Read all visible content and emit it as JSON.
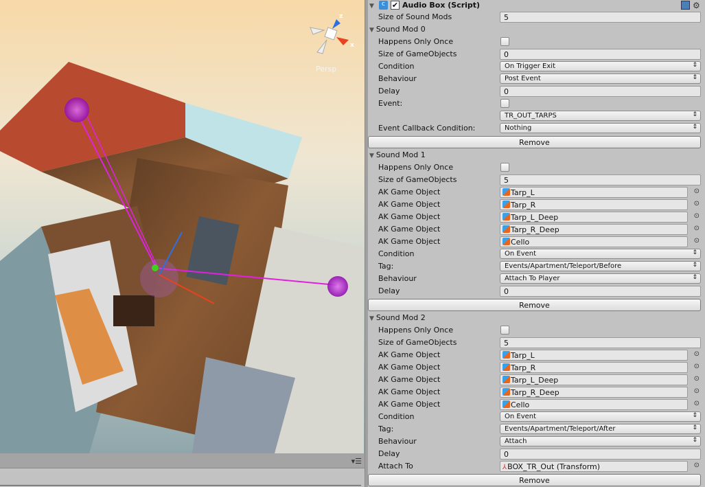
{
  "scene": {
    "view_mode": "Persp",
    "gizmo_axes": {
      "z": "z",
      "x": "x"
    }
  },
  "inspector": {
    "component": {
      "title": "Audio Box (Script)",
      "enabled": true,
      "icons": [
        "script-icon",
        "help-book-icon",
        "gear-icon"
      ]
    },
    "size_of_sound_mods": {
      "label": "Size of Sound Mods",
      "value": "5"
    },
    "sound_mods": [
      {
        "title": "Sound Mod 0",
        "rows": [
          {
            "type": "checkbox",
            "label": "Happens Only Once",
            "checked": false
          },
          {
            "type": "text",
            "label": "Size of GameObjects",
            "value": "0"
          },
          {
            "type": "dropdown",
            "label": "Condition",
            "value": "On Trigger Exit"
          },
          {
            "type": "dropdown",
            "label": "Behaviour",
            "value": "Post Event"
          },
          {
            "type": "text",
            "label": "Delay",
            "value": "0"
          },
          {
            "type": "checkbox",
            "label": "Event:",
            "checked": false
          },
          {
            "type": "dropdown",
            "label": "",
            "value": "TR_OUT_TARPS"
          },
          {
            "type": "dropdown",
            "label": "Event Callback Condition:",
            "value": "Nothing"
          }
        ],
        "remove_label": "Remove"
      },
      {
        "title": "Sound Mod 1",
        "rows": [
          {
            "type": "checkbox",
            "label": "Happens Only Once",
            "checked": false
          },
          {
            "type": "text",
            "label": "Size of GameObjects",
            "value": "5"
          },
          {
            "type": "object",
            "label": "AK Game Object",
            "value": "Tarp_L",
            "icon": "gameobject-icon"
          },
          {
            "type": "object",
            "label": "AK Game Object",
            "value": "Tarp_R",
            "icon": "gameobject-icon"
          },
          {
            "type": "object",
            "label": "AK Game Object",
            "value": "Tarp_L_Deep",
            "icon": "gameobject-icon"
          },
          {
            "type": "object",
            "label": "AK Game Object",
            "value": "Tarp_R_Deep",
            "icon": "gameobject-icon"
          },
          {
            "type": "object",
            "label": "AK Game Object",
            "value": "Cello",
            "icon": "gameobject-icon"
          },
          {
            "type": "dropdown",
            "label": "Condition",
            "value": "On Event"
          },
          {
            "type": "dropdown",
            "label": "Tag:",
            "value": "Events/Apartment/Teleport/Before"
          },
          {
            "type": "dropdown",
            "label": "Behaviour",
            "value": "Attach To Player"
          },
          {
            "type": "text",
            "label": "Delay",
            "value": "0"
          }
        ],
        "remove_label": "Remove"
      },
      {
        "title": "Sound Mod 2",
        "rows": [
          {
            "type": "checkbox",
            "label": "Happens Only Once",
            "checked": false
          },
          {
            "type": "text",
            "label": "Size of GameObjects",
            "value": "5"
          },
          {
            "type": "object",
            "label": "AK Game Object",
            "value": "Tarp_L",
            "icon": "gameobject-icon"
          },
          {
            "type": "object",
            "label": "AK Game Object",
            "value": "Tarp_R",
            "icon": "gameobject-icon"
          },
          {
            "type": "object",
            "label": "AK Game Object",
            "value": "Tarp_L_Deep",
            "icon": "gameobject-icon"
          },
          {
            "type": "object",
            "label": "AK Game Object",
            "value": "Tarp_R_Deep",
            "icon": "gameobject-icon"
          },
          {
            "type": "object",
            "label": "AK Game Object",
            "value": "Cello",
            "icon": "gameobject-icon"
          },
          {
            "type": "dropdown",
            "label": "Condition",
            "value": "On Event"
          },
          {
            "type": "dropdown",
            "label": "Tag:",
            "value": "Events/Apartment/Teleport/After"
          },
          {
            "type": "dropdown",
            "label": "Behaviour",
            "value": "Attach"
          },
          {
            "type": "text",
            "label": "Delay",
            "value": "0"
          },
          {
            "type": "object",
            "label": "Attach To",
            "value": "BOX_TR_Out (Transform)",
            "icon": "transform-icon"
          }
        ],
        "remove_label": "Remove"
      }
    ]
  },
  "colors": {
    "gizmo_x": "#e8431c",
    "gizmo_z": "#2f6fe0",
    "sound_sphere": "#b020d0",
    "ray": "#e020e0"
  }
}
